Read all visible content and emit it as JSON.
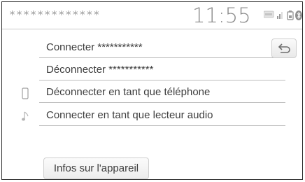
{
  "header": {
    "device_name": "*************",
    "time": "11:55",
    "icons": [
      "bluetooth-audio-badge-icon",
      "signal-strength-icon",
      "battery-icon",
      "bluetooth-icon"
    ]
  },
  "menu": {
    "items": [
      {
        "label": "Connecter ***********",
        "icon": ""
      },
      {
        "label": "Déconnecter ***********",
        "icon": ""
      },
      {
        "label": "Déconnecter en tant que téléphone",
        "icon": "phone-icon"
      },
      {
        "label": "Connecter en tant que lecteur audio",
        "icon": "music-note-icon"
      }
    ]
  },
  "buttons": {
    "back_icon": "return-arrow-icon",
    "info_label": "Infos sur l'appareil"
  }
}
